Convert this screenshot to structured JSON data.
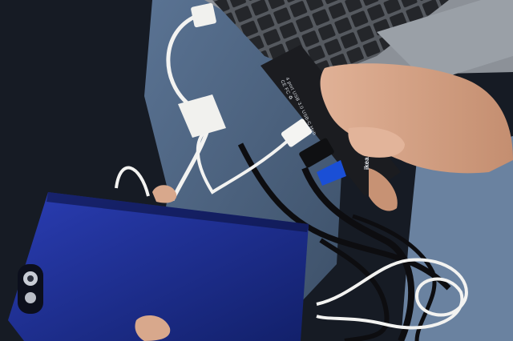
{
  "photo": {
    "subject": "",
    "hub_label_line1": "4 port USB 3.0 USB-C Hub",
    "hub_label_line2": "CE FC ♻",
    "hub_brand": "ikea"
  },
  "colors": {
    "background": "#1c2330",
    "laptop": "#8a8f96",
    "keyboard": "#2b2d31",
    "jeans": "#4f6580",
    "phone_case": "#1d2c8c",
    "hub": "#1b1c20",
    "skin": "#d6a487",
    "cable_white": "#f3f3f1",
    "cable_black": "#0d0d10"
  }
}
